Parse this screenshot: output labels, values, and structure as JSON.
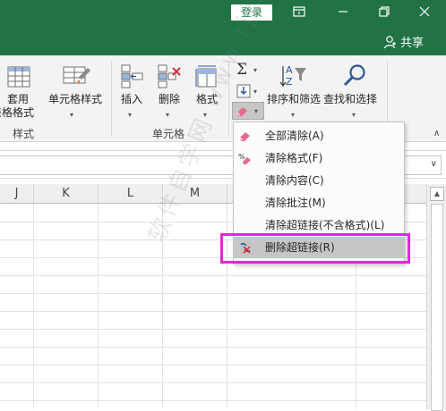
{
  "titlebar": {
    "login_label": "登录",
    "share_label": "共享"
  },
  "ribbon": {
    "styles_group": {
      "table_format_label_1": "套用",
      "table_format_label_2": "表格格式",
      "cell_styles_label": "单元格样式",
      "group_label": "样式"
    },
    "cells_group": {
      "insert_label": "插入",
      "delete_label": "删除",
      "format_label": "格式",
      "group_label": "单元格"
    },
    "editing_group": {
      "sort_filter_label": "排序和筛选",
      "find_select_label": "查找和选择"
    }
  },
  "columns": [
    "J",
    "K",
    "L",
    "M"
  ],
  "clear_menu": {
    "items": [
      {
        "label": "全部清除(A)",
        "icon": "eraser-icon"
      },
      {
        "label": "清除格式(F)",
        "icon": "clear-format-icon"
      },
      {
        "label": "清除内容(C)",
        "icon": ""
      },
      {
        "label": "清除批注(M)",
        "icon": ""
      },
      {
        "label": "清除超链接(不含格式)(L)",
        "icon": ""
      },
      {
        "label": "删除超链接(R)",
        "icon": "remove-hyperlink-icon"
      }
    ]
  },
  "watermark": "软件自学网 www.rjzxw.com",
  "colors": {
    "accent": "#217346",
    "highlight_box": "#e627d6"
  }
}
